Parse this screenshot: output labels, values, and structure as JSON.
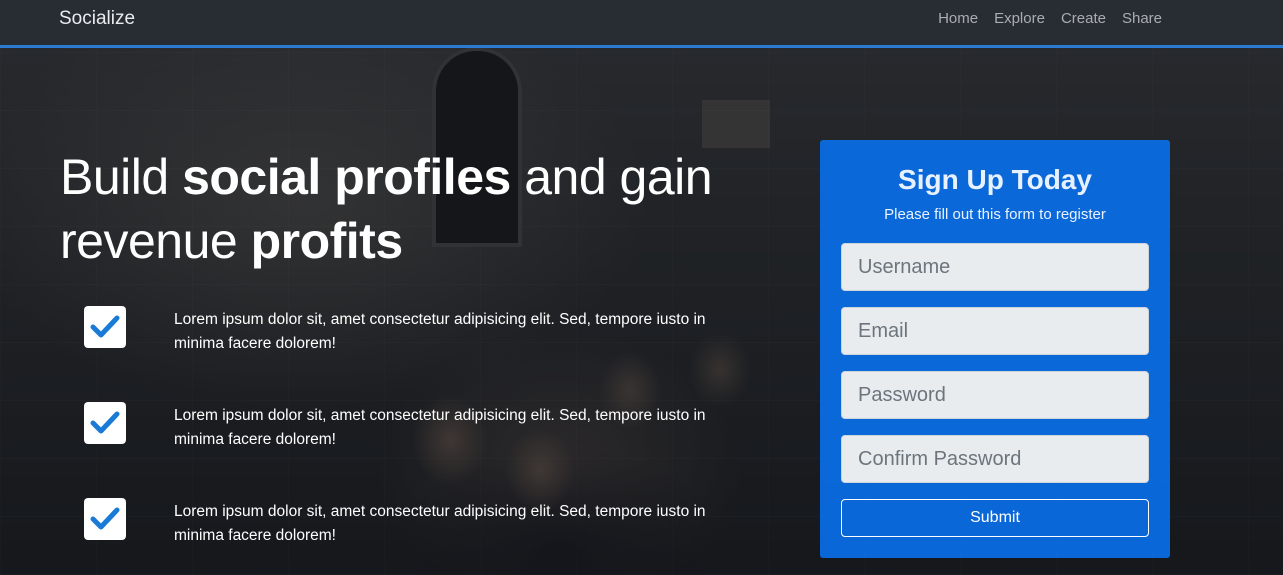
{
  "navbar": {
    "brand": "Socialize",
    "links": [
      {
        "label": "Home"
      },
      {
        "label": "Explore"
      },
      {
        "label": "Create"
      },
      {
        "label": "Share"
      }
    ],
    "accent_color": "#2a7bd1"
  },
  "hero": {
    "headline": {
      "part1": "Build ",
      "bold1": "social profiles",
      "part2": " and gain revenue ",
      "bold2": "profits"
    },
    "features": [
      {
        "icon": "check-icon",
        "text": "Lorem ipsum dolor sit, amet consectetur adipisicing elit. Sed, tempore iusto in minima facere dolorem!"
      },
      {
        "icon": "check-icon",
        "text": "Lorem ipsum dolor sit, amet consectetur adipisicing elit. Sed, tempore iusto in minima facere dolorem!"
      },
      {
        "icon": "check-icon",
        "text": "Lorem ipsum dolor sit, amet consectetur adipisicing elit. Sed, tempore iusto in minima facere dolorem!"
      }
    ],
    "check_color": "#1a7bd6"
  },
  "signup": {
    "title": "Sign Up Today",
    "subtitle": "Please fill out this form to register",
    "fields": {
      "username": {
        "value": "",
        "placeholder": "Username"
      },
      "email": {
        "value": "",
        "placeholder": "Email"
      },
      "password": {
        "value": "",
        "placeholder": "Password"
      },
      "confirm": {
        "value": "",
        "placeholder": "Confirm Password"
      }
    },
    "submit_label": "Submit",
    "card_color": "#0a6ee6"
  }
}
